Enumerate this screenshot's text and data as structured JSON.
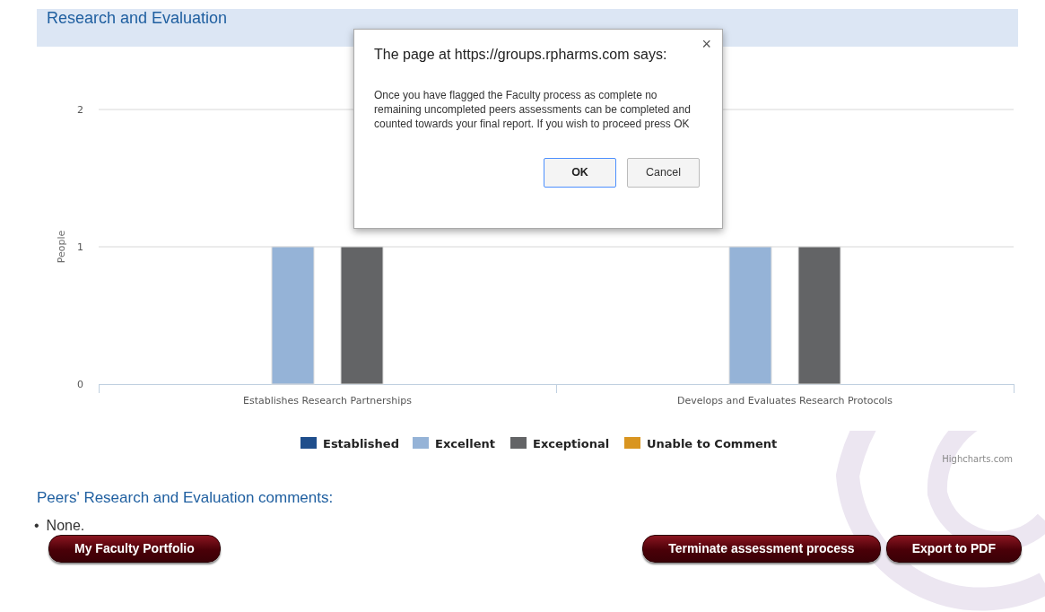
{
  "section": {
    "title": "Research and Evaluation"
  },
  "chart": {
    "chart_data": {
      "type": "bar",
      "ylabel": "People",
      "legend": true,
      "categories": [
        "Establishes Research Partnerships",
        "Develops and Evaluates Research Protocols"
      ],
      "yticks": [
        0,
        1,
        2
      ],
      "ylim": [
        0,
        2
      ],
      "series": [
        {
          "name": "Established",
          "color": "#1f4e8c",
          "values": [
            0,
            0
          ]
        },
        {
          "name": "Excellent",
          "color": "#95b3d7",
          "values": [
            1,
            1
          ]
        },
        {
          "name": "Exceptional",
          "color": "#636466",
          "values": [
            1,
            1
          ]
        },
        {
          "name": "Unable to Comment",
          "color": "#d99520",
          "values": [
            0,
            0
          ]
        }
      ]
    },
    "credit": "Highcharts.com"
  },
  "comments": {
    "heading": "Peers' Research and Evaluation comments:",
    "items": [
      {
        "marker": "•",
        "text": "None."
      }
    ]
  },
  "left_buttons": [
    "My Faculty Portfolio"
  ],
  "right_buttons": [
    "Terminate assessment process",
    "Export to PDF"
  ],
  "dialog": {
    "title": "The page at https://groups.rpharms.com says:",
    "close": "×",
    "message": "Once you have flagged the Faculty process as complete no remaining uncompleted peers assessments can be completed and counted towards your final report.  If you wish to proceed press OK",
    "buttons": [
      {
        "label": "OK",
        "default": true
      },
      {
        "label": "Cancel",
        "default": false
      }
    ]
  }
}
